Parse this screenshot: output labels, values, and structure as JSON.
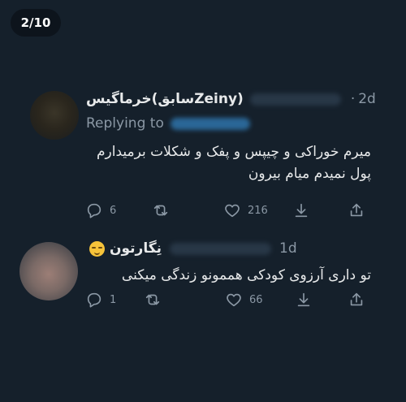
{
  "viewer": {
    "counter": "2/10"
  },
  "tweets": [
    {
      "display_name": "خرماگیس(سابقZeiny)",
      "time": "2d",
      "replying_to": "Replying to",
      "text_lines": [
        "میرم خوراکی و چیپس و پفک و شکلات برمیدارم",
        "پول نمیدم میام بیرون"
      ],
      "counts": {
        "replies": "6",
        "retweets": "",
        "likes": "216"
      }
    },
    {
      "display_name": "نِگارتون",
      "time": "1d",
      "text_lines": [
        "تو داری آرزوی کودکی هممونو زندگی میکنی"
      ],
      "counts": {
        "replies": "1",
        "retweets": "",
        "likes": "66"
      }
    }
  ],
  "icons": [
    "reply-icon",
    "retweet-icon",
    "like-icon",
    "download-icon",
    "share-icon"
  ],
  "colors": {
    "background": "#15202b",
    "text": "#e7e9ea",
    "muted": "#8b98a5",
    "link": "#1d9bf0"
  }
}
